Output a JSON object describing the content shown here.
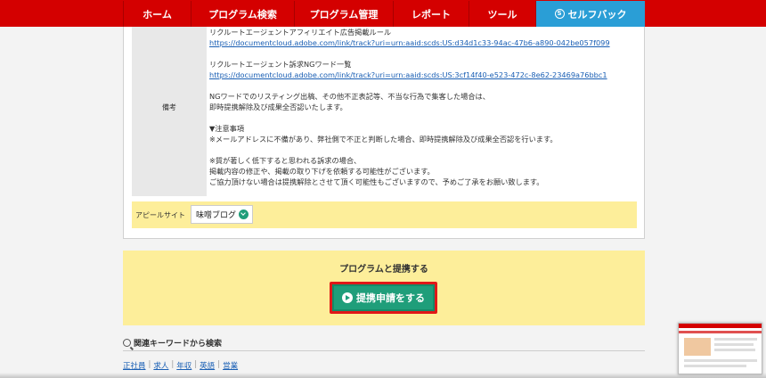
{
  "nav": {
    "items": [
      "ホーム",
      "プログラム検索",
      "プログラム管理",
      "レポート",
      "ツール"
    ],
    "self_back": {
      "icon_glyph": "S",
      "label": "セルフバック"
    }
  },
  "remarks": {
    "label": "備考",
    "lines": [
      {
        "text": "リクルートエージェントアフィリエイト広告掲載ルール",
        "link": false
      },
      {
        "text": "https://documentcloud.adobe.com/link/track?uri=urn:aaid:scds:US:d34d1c33-94ac-47b6-a890-042be057f099",
        "link": true
      },
      {
        "text": "",
        "link": false
      },
      {
        "text": "リクルートエージェント訴求NGワード一覧",
        "link": false
      },
      {
        "text": "https://documentcloud.adobe.com/link/track?uri=urn:aaid:scds:US:3cf14f40-e523-472c-8e62-23469a76bbc1",
        "link": true
      },
      {
        "text": "",
        "link": false
      },
      {
        "text": "NGワードでのリスティング出稿、その他不正表記等、不当な行為で集客した場合は、",
        "link": false
      },
      {
        "text": "即時提携解除及び成果全否認いたします。",
        "link": false
      },
      {
        "text": "",
        "link": false
      },
      {
        "text": "▼注意事項",
        "link": false
      },
      {
        "text": "※メールアドレスに不備があり、弊社側で不正と判断した場合、即時提携解除及び成果全否認を行います。",
        "link": false
      },
      {
        "text": "",
        "link": false
      },
      {
        "text": "※質が著しく低下すると思われる訴求の場合、",
        "link": false
      },
      {
        "text": "掲載内容の修正や、掲載の取り下げを依頼する可能性がございます。",
        "link": false
      },
      {
        "text": "ご協力頂けない場合は提携解除とさせて頂く可能性もございますので、予めご了承をお願い致します。",
        "link": false
      }
    ]
  },
  "appeal": {
    "label": "アピールサイト",
    "selected": "味噌ブログ"
  },
  "cta": {
    "title": "プログラムと提携する",
    "button": "提携申請をする"
  },
  "keywords": {
    "heading": "関連キーワードから検索",
    "items": [
      "正社員",
      "求人",
      "年収",
      "英語",
      "営業"
    ]
  },
  "colors": {
    "nav_red": "#d40000",
    "accent_blue": "#2a9ed6",
    "cta_green": "#1f9e7a",
    "highlight_yellow": "#fdee9a",
    "link_blue": "#1a5fb4"
  }
}
